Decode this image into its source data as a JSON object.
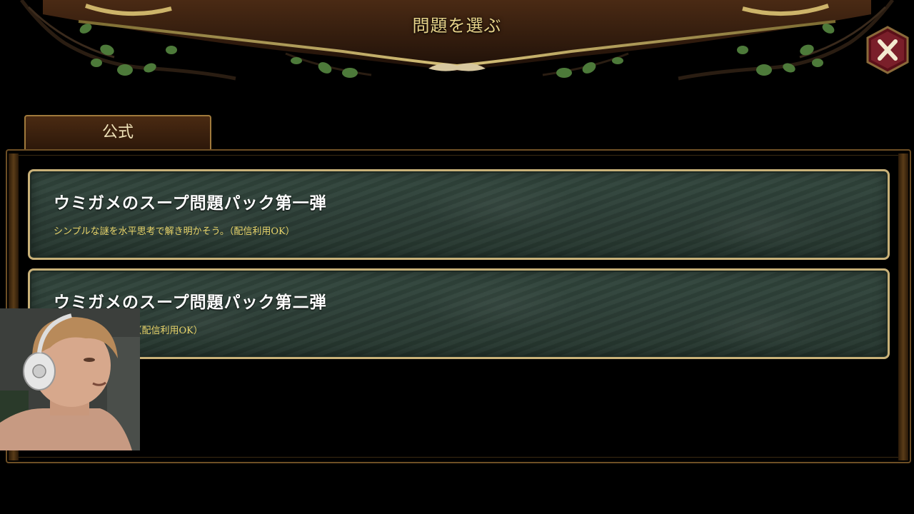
{
  "header": {
    "title": "問題を選ぶ"
  },
  "close": {
    "icon": "close-icon"
  },
  "tabs": [
    {
      "label": "公式",
      "selected": true
    }
  ],
  "packs": [
    {
      "title": "ウミガメのスープ問題パック第一弾",
      "description": "シンプルな謎を水平思考で解き明かそう。（配信利用OK）"
    },
    {
      "title": "ウミガメのスープ問題パック第二弾",
      "description": "水平思考の世界へ。（配信利用OK）"
    }
  ],
  "colors": {
    "title_gold": "#e8d48a",
    "card_border": "#c9b178",
    "card_bg": "#2e4038",
    "desc_yellow": "#e8d46a",
    "close_red": "#7a1f2a"
  }
}
